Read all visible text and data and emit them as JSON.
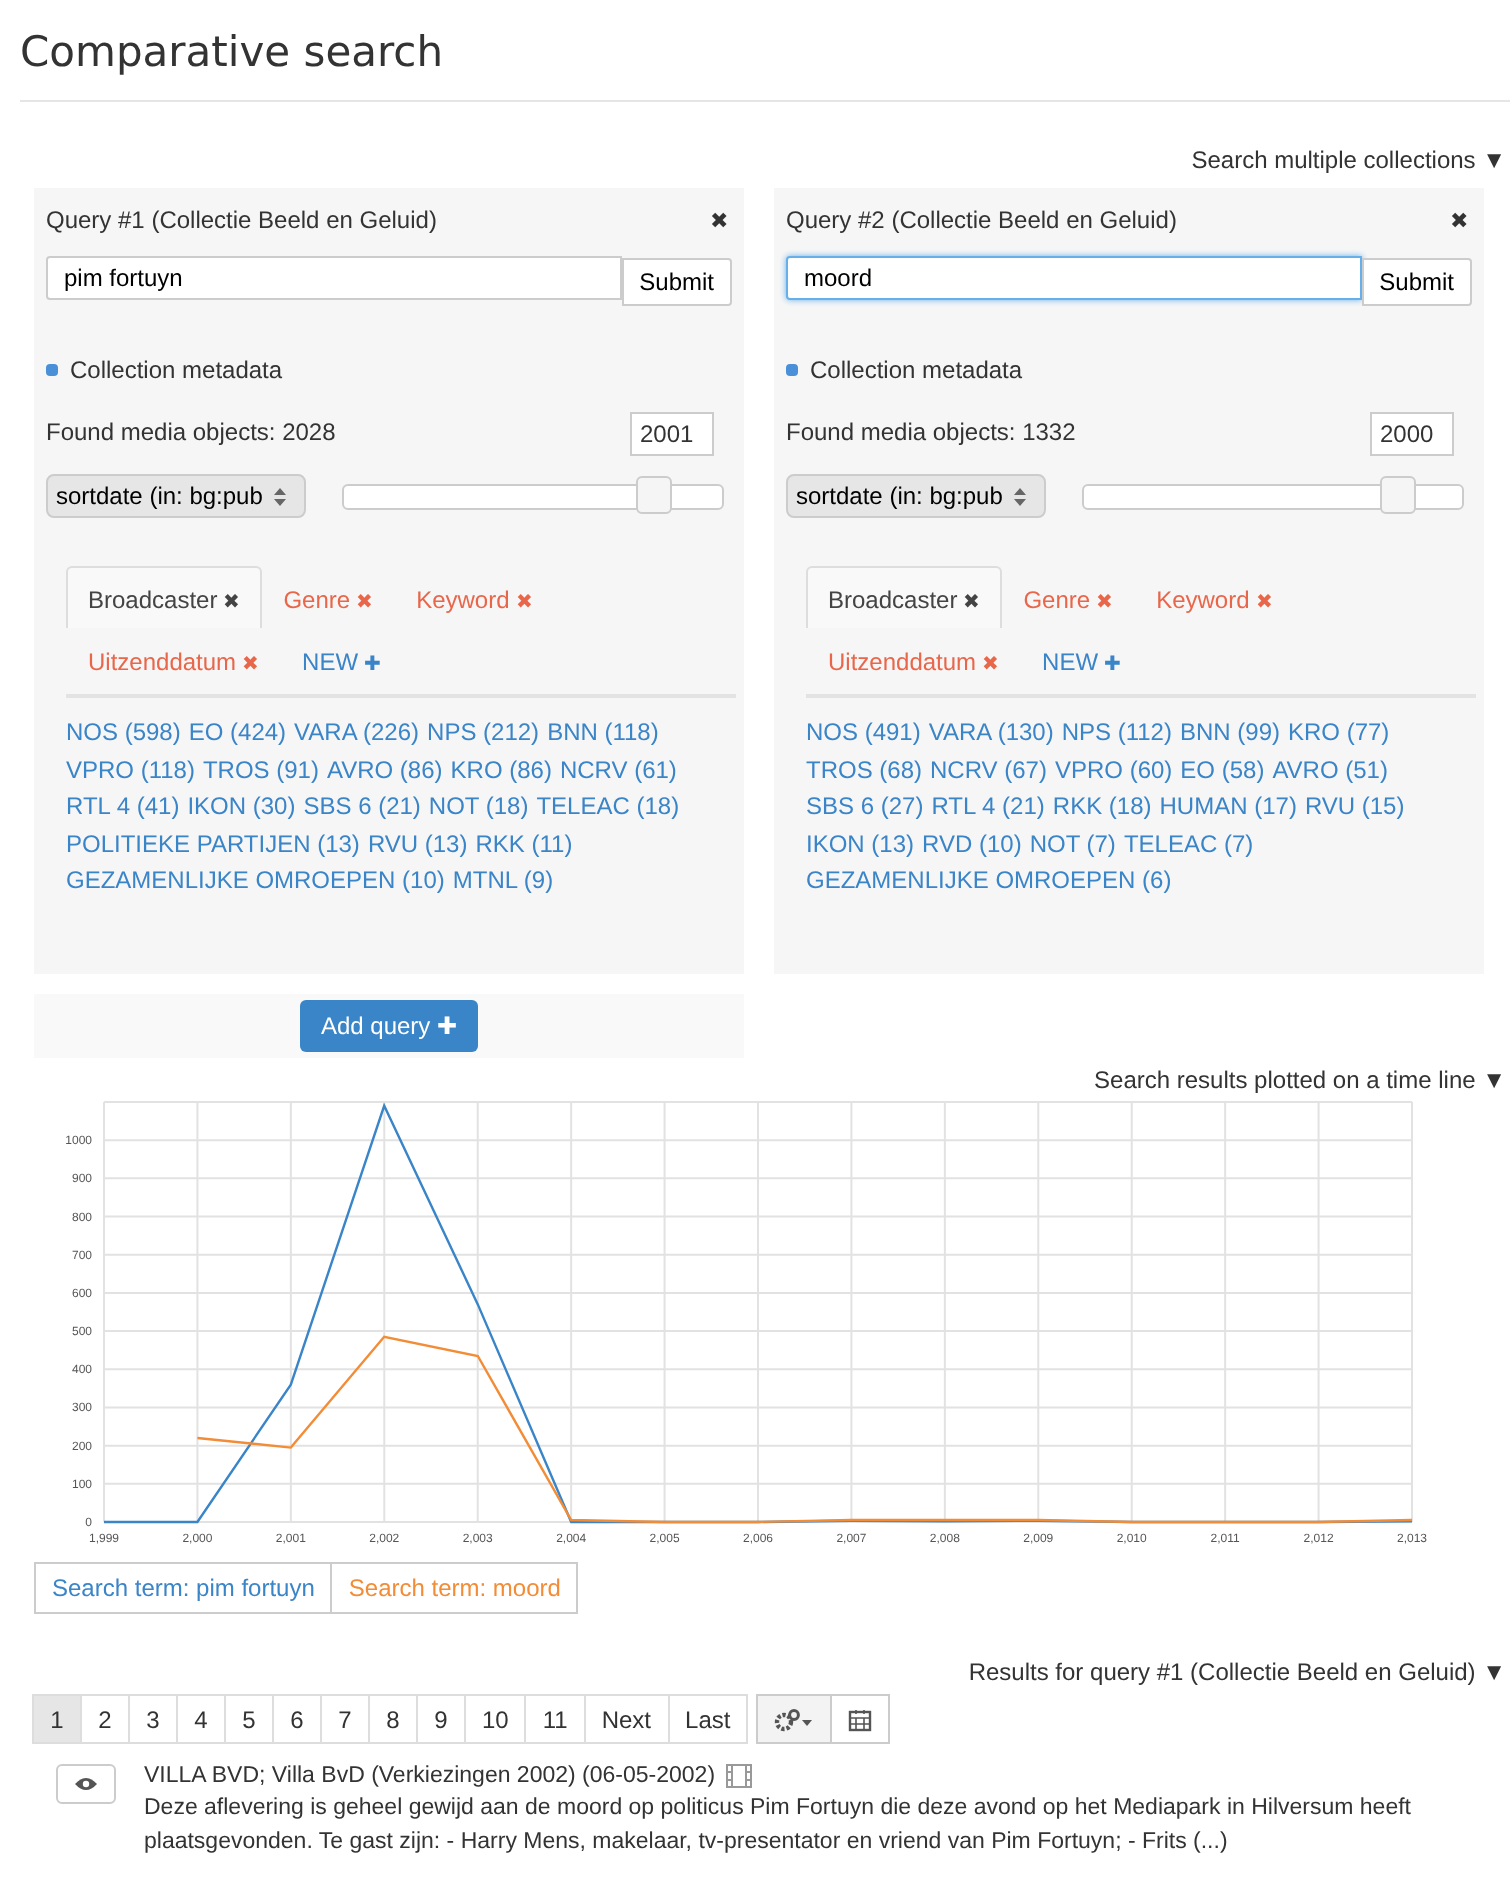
{
  "page_title": "Comparative search",
  "collections_toggle": "Search multiple collections ▼",
  "queries": [
    {
      "title": "Query #1 (Collectie Beeld en Geluid)",
      "close": "✖",
      "value": "pim fortuyn",
      "focused": false,
      "submit": "Submit",
      "metadata": {
        "label": "Collection metadata",
        "checked": true
      },
      "found": "Found media objects: 2028",
      "year": "2001",
      "sort": "sortdate (in: bg:pub",
      "level": 0.82,
      "facets": [
        {
          "kind": "facet",
          "label": "Broadcaster",
          "icon": "✖",
          "selected": true
        },
        {
          "kind": "facet",
          "label": "Genre",
          "icon": "✖",
          "selected": false
        },
        {
          "kind": "facet",
          "label": "Keyword",
          "icon": "✖",
          "selected": false
        },
        {
          "kind": "facet",
          "label": "Uitzenddatum",
          "icon": "✖",
          "selected": false
        },
        {
          "kind": "new",
          "label": "NEW",
          "icon": "✚",
          "selected": false
        }
      ],
      "values": [
        [
          "NOS (598)",
          "EO (424)",
          "VARA (226)",
          "NPS (212)",
          "BNN (118)"
        ],
        [
          "VPRO (118)",
          "TROS (91)",
          "AVRO (86)",
          "KRO (86)",
          "NCRV (61)"
        ],
        [
          "RTL 4 (41)",
          "IKON (30)",
          "SBS 6 (21)",
          "NOT (18)",
          "TELEAC (18)"
        ],
        [
          "POLITIEKE PARTIJEN (13)",
          "RVU (13)",
          "RKK (11)"
        ],
        [
          "GEZAMENLIJKE OMROEPEN (10)",
          "MTNL (9)"
        ]
      ]
    },
    {
      "title": "Query #2 (Collectie Beeld en Geluid)",
      "close": "✖",
      "value": "moord",
      "focused": true,
      "submit": "Submit",
      "metadata": {
        "label": "Collection metadata",
        "checked": true
      },
      "found": "Found media objects: 1332",
      "year": "2000",
      "sort": "sortdate (in: bg:pub",
      "level": 0.83,
      "facets": [
        {
          "kind": "facet",
          "label": "Broadcaster",
          "icon": "✖",
          "selected": true
        },
        {
          "kind": "facet",
          "label": "Genre",
          "icon": "✖",
          "selected": false
        },
        {
          "kind": "facet",
          "label": "Keyword",
          "icon": "✖",
          "selected": false
        },
        {
          "kind": "facet",
          "label": "Uitzenddatum",
          "icon": "✖",
          "selected": false
        },
        {
          "kind": "new",
          "label": "NEW",
          "icon": "✚",
          "selected": false
        }
      ],
      "values": [
        [
          "NOS (491)",
          "VARA (130)",
          "NPS (112)",
          "BNN (99)",
          "KRO (77)"
        ],
        [
          "TROS (68)",
          "NCRV (67)",
          "VPRO (60)",
          "EO (58)",
          "AVRO (51)"
        ],
        [
          "SBS 6 (27)",
          "RTL 4 (21)",
          "RKK (18)",
          "HUMAN (17)",
          "RVU (15)"
        ],
        [
          "IKON (13)",
          "RVD (10)",
          "NOT (7)",
          "TELEAC (7)"
        ],
        [
          "GEZAMENLIJKE OMROEPEN (6)"
        ]
      ]
    }
  ],
  "add_query": "Add query ✚",
  "timeline": {
    "toggle": "Search results plotted on a time line ▼",
    "chart_data": {
      "type": "line",
      "x": [
        1999,
        2000,
        2001,
        2002,
        2003,
        2004,
        2005,
        2006,
        2007,
        2008,
        2009,
        2010,
        2011,
        2012,
        2013
      ],
      "xticks": [
        {
          "value": 1999,
          "label": "1,999"
        },
        {
          "value": 2000,
          "label": "2,000"
        },
        {
          "value": 2001,
          "label": "2,001"
        },
        {
          "value": 2002,
          "label": "2,002"
        },
        {
          "value": 2003,
          "label": "2,003"
        },
        {
          "value": 2004,
          "label": "2,004"
        },
        {
          "value": 2005,
          "label": "2,005"
        },
        {
          "value": 2006,
          "label": "2,006"
        },
        {
          "value": 2007,
          "label": "2,007"
        },
        {
          "value": 2008,
          "label": "2,008"
        },
        {
          "value": 2009,
          "label": "2,009"
        },
        {
          "value": 2010,
          "label": "2,010"
        },
        {
          "value": 2011,
          "label": "2,011"
        },
        {
          "value": 2012,
          "label": "2,012"
        },
        {
          "value": 2013,
          "label": "2,013"
        }
      ],
      "xlim": [
        1999,
        2013
      ],
      "yticks": [
        0,
        100,
        200,
        300,
        400,
        500,
        600,
        700,
        800,
        900,
        1000
      ],
      "ylim": [
        0,
        1100
      ],
      "grid": true,
      "series": [
        {
          "name": "pim fortuyn",
          "color": "#3a84c8",
          "values": [
            0,
            0,
            360,
            1090,
            570,
            0,
            0,
            0,
            3,
            2,
            3,
            0,
            0,
            0,
            2
          ]
        },
        {
          "name": "moord",
          "color": "#f28c36",
          "values": [
            null,
            220,
            195,
            485,
            435,
            5,
            0,
            0,
            5,
            5,
            5,
            0,
            0,
            0,
            5
          ]
        }
      ]
    },
    "legend": [
      {
        "prefix": "Search term:"
      },
      {
        "prefix": "Search term:"
      }
    ]
  },
  "results": {
    "heading": "Results for query #1 (Collectie Beeld en Geluid) ▼",
    "pages": [
      {
        "label": "1",
        "selected": true
      },
      {
        "label": "2",
        "selected": false
      },
      {
        "label": "3",
        "selected": false
      },
      {
        "label": "4",
        "selected": false
      },
      {
        "label": "5",
        "selected": false
      },
      {
        "label": "6",
        "selected": false
      },
      {
        "label": "7",
        "selected": false
      },
      {
        "label": "8",
        "selected": false
      },
      {
        "label": "9",
        "selected": false
      },
      {
        "label": "10",
        "selected": false
      },
      {
        "label": "11",
        "selected": false
      },
      {
        "label": "Next",
        "selected": false
      },
      {
        "label": "Last",
        "selected": false
      }
    ],
    "items": [
      {
        "title": "VILLA BVD; Villa BvD (Verkiezingen 2002) (06-05-2002)",
        "description": "Deze aflevering is geheel gewijd aan de moord op politicus Pim Fortuyn die deze avond op het Mediapark in Hilversum heeft plaatsgevonden. Te gast zijn: - Harry Mens, makelaar, tv-presentator en vriend van Pim Fortuyn; - Frits (...)"
      }
    ]
  }
}
